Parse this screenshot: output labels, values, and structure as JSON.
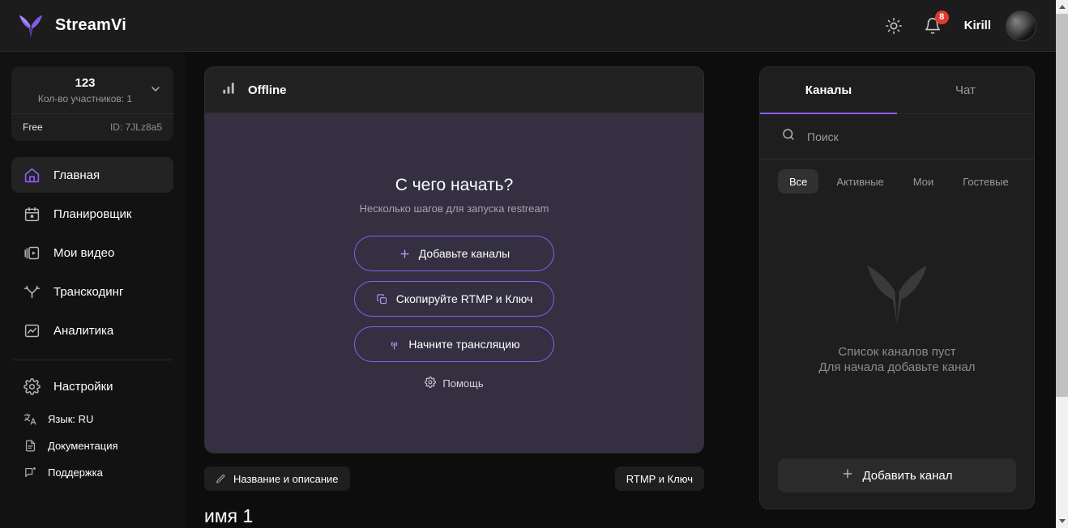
{
  "header": {
    "brand_name": "StreamVi",
    "logo_icon": "butterfly-logo",
    "theme_icon": "sun-icon",
    "notifications_icon": "bell-icon",
    "notifications_count": "8",
    "user_name": "Kirill",
    "avatar_icon": "user-avatar"
  },
  "sidebar": {
    "workspace": {
      "title": "123",
      "members_label": "Кол-во участников: 1",
      "plan": "Free",
      "id": "ID: 7JLz8a5",
      "chevron_icon": "chevron-down-icon"
    },
    "nav": [
      {
        "label": "Главная",
        "icon": "home-icon",
        "active": true
      },
      {
        "label": "Планировщик",
        "icon": "calendar-icon",
        "active": false
      },
      {
        "label": "Мои видео",
        "icon": "video-library-icon",
        "active": false
      },
      {
        "label": "Транскодинг",
        "icon": "branch-icon",
        "active": false
      },
      {
        "label": "Аналитика",
        "icon": "chart-icon",
        "active": false
      }
    ],
    "settings": {
      "label": "Настройки",
      "icon": "gear-icon"
    },
    "mini": [
      {
        "label": "Язык: RU",
        "icon": "translate-icon"
      },
      {
        "label": "Документация",
        "icon": "document-icon"
      },
      {
        "label": "Поддержка",
        "icon": "support-icon"
      }
    ]
  },
  "main": {
    "status": "Offline",
    "status_icon": "signal-bars-icon",
    "preview": {
      "title": "С чего начать?",
      "subtitle": "Несколько шагов для запуска restream",
      "buttons": [
        {
          "label": "Добавьте каналы",
          "icon": "plus-icon"
        },
        {
          "label": "Скопируйте RTMP и Ключ",
          "icon": "copy-icon"
        },
        {
          "label": "Начните трансляцию",
          "icon": "broadcast-icon"
        }
      ],
      "help_label": "Помощь",
      "help_icon": "gear-icon"
    },
    "title_pill": {
      "label": "Название и описание",
      "icon": "pencil-icon"
    },
    "rtmp_pill": {
      "label": "RTMP и Ключ"
    },
    "stream_name": "имя 1"
  },
  "right_panel": {
    "tabs": [
      {
        "label": "Каналы",
        "active": true
      },
      {
        "label": "Чат",
        "active": false
      }
    ],
    "search": {
      "placeholder": "Поиск",
      "value": "",
      "icon": "search-icon"
    },
    "filters": [
      {
        "label": "Все",
        "active": true
      },
      {
        "label": "Активные",
        "active": false
      },
      {
        "label": "Мои",
        "active": false
      },
      {
        "label": "Гостевые",
        "active": false
      }
    ],
    "empty": {
      "watermark_icon": "butterfly-logo",
      "line1": "Список каналов пуст",
      "line2": "Для начала добавьте канал"
    },
    "add_button": {
      "label": "Добавить канал",
      "icon": "plus-icon"
    }
  },
  "colors": {
    "accent": "#8b5cf6",
    "badge": "#e03a2f",
    "page_bg": "#0d0d0d",
    "card_bg": "#1e1e1e",
    "preview_bg": "#343041"
  }
}
